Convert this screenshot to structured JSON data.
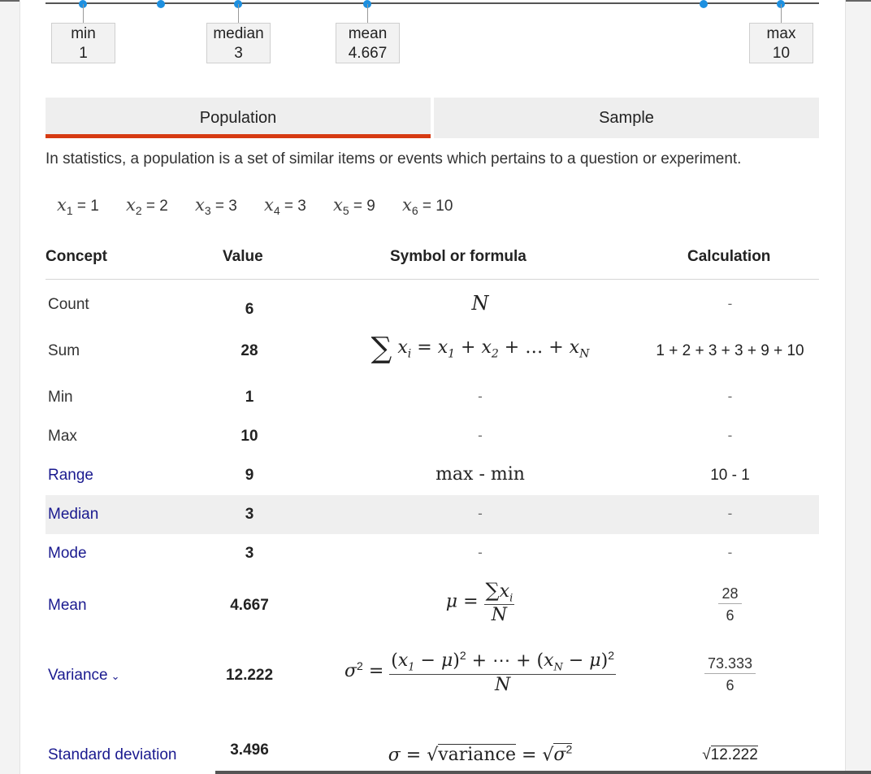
{
  "boxplot": {
    "min": {
      "label": "min",
      "value": "1"
    },
    "median": {
      "label": "median",
      "value": "3"
    },
    "mean": {
      "label": "mean",
      "value": "4.667"
    },
    "max": {
      "label": "max",
      "value": "10"
    }
  },
  "tabs": [
    {
      "label": "Population",
      "active": true
    },
    {
      "label": "Sample",
      "active": false
    }
  ],
  "description": "In statistics, a population is a set of similar items or events which pertains to a question or experiment.",
  "x_values": [
    {
      "sub": "1",
      "val": "1"
    },
    {
      "sub": "2",
      "val": "2"
    },
    {
      "sub": "3",
      "val": "3"
    },
    {
      "sub": "4",
      "val": "3"
    },
    {
      "sub": "5",
      "val": "9"
    },
    {
      "sub": "6",
      "val": "10"
    }
  ],
  "table": {
    "headers": {
      "concept": "Concept",
      "value": "Value",
      "formula": "Symbol or formula",
      "calc": "Calculation"
    },
    "rows": [
      {
        "concept": "Count",
        "value": "6",
        "calc": "-"
      },
      {
        "concept": "Sum",
        "value": "28",
        "calc": "1 + 2 + 3 + 3 + 9 + 10"
      },
      {
        "concept": "Min",
        "value": "1",
        "formula": "-",
        "calc": "-"
      },
      {
        "concept": "Max",
        "value": "10",
        "formula": "-",
        "calc": "-"
      },
      {
        "concept": "Range",
        "value": "9",
        "formula": "max - min",
        "calc": "10 - 1"
      },
      {
        "concept": "Median",
        "value": "3",
        "formula": "-",
        "calc": "-"
      },
      {
        "concept": "Mode",
        "value": "3",
        "formula": "-",
        "calc": "-"
      },
      {
        "concept": "Mean",
        "value": "4.667",
        "calc_num": "28",
        "calc_den": "6"
      },
      {
        "concept": "Variance",
        "value": "12.222",
        "calc_num": "73.333",
        "calc_den": "6"
      },
      {
        "concept": "Standard deviation",
        "value": "3.496",
        "calc": "12.222"
      }
    ]
  },
  "colors": {
    "accent": "#d63a12",
    "link": "#1a1a8f",
    "dot": "#1e90e0"
  }
}
